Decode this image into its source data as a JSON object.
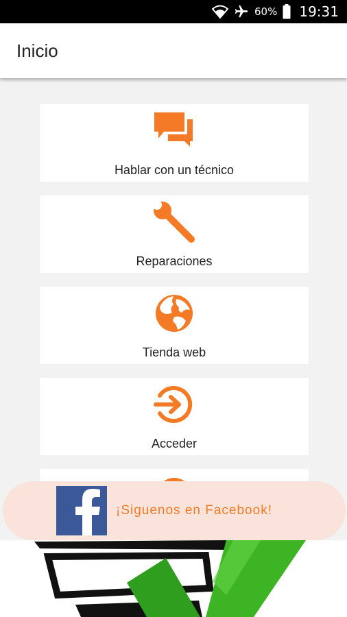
{
  "status_bar": {
    "battery": "60%",
    "time": "19:31",
    "icons": [
      "wifi-icon",
      "airplane-icon",
      "battery-icon"
    ]
  },
  "app_bar": {
    "title": "Inicio"
  },
  "menu": [
    {
      "label": "Hablar con un técnico",
      "icon": "chat-icon"
    },
    {
      "label": "Reparaciones",
      "icon": "wrench-icon"
    },
    {
      "label": "Tienda web",
      "icon": "globe-icon"
    },
    {
      "label": "Acceder",
      "icon": "login-icon"
    }
  ],
  "facebook_bar": {
    "text": "¡Siguenos en Facebook!",
    "icon": "facebook-icon"
  },
  "banner": {
    "image": "checklist-checkmark-image"
  },
  "colors": {
    "accent": "#f47a25",
    "facebook_blue": "#3b5998",
    "facebook_bar_bg": "#fae3da",
    "check_green": "#3cb424",
    "background": "#f2f2f2"
  }
}
